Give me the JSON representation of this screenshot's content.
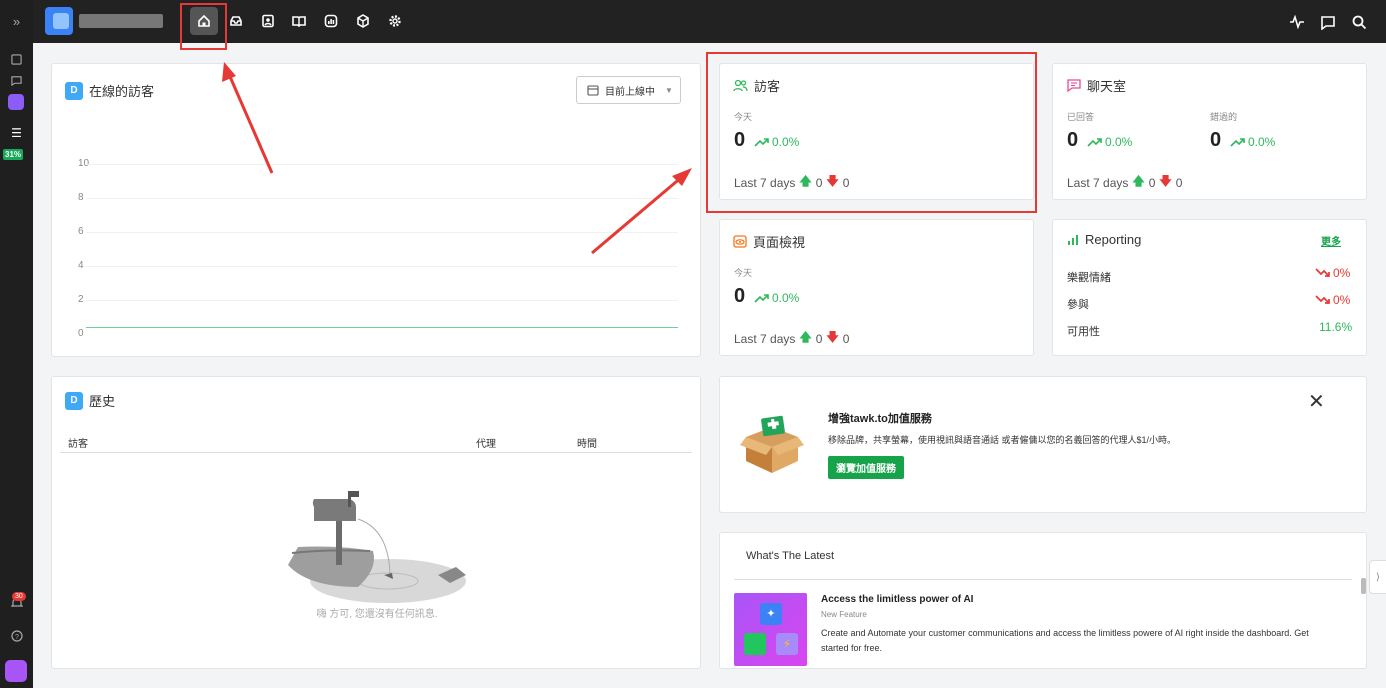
{
  "rail": {
    "progress_badge": "31%",
    "notification_count": "30"
  },
  "nav": {
    "icons": [
      "home-icon",
      "inbox-icon",
      "contacts-icon",
      "knowledge-base-icon",
      "reporting-icon",
      "addons-icon",
      "settings-icon"
    ],
    "right_icons": [
      "activity-icon",
      "chat-icon",
      "search-icon"
    ]
  },
  "online_visitors": {
    "badge": "D",
    "title": "在線的訪客",
    "dropdown": "目前上線中",
    "chart_data": {
      "type": "line",
      "yticks": [
        "10",
        "8",
        "6",
        "4",
        "2",
        "0"
      ],
      "ylim": [
        0,
        10
      ],
      "series": [
        {
          "values": [
            0,
            0
          ]
        }
      ],
      "line_color": "#6fcf97"
    }
  },
  "visitors": {
    "title": "訪客",
    "today_label": "今天",
    "value": "0",
    "trend": "0.0%",
    "last7_label": "Last 7 days",
    "up": "0",
    "down": "0"
  },
  "chat": {
    "title": "聊天室",
    "answered_label": "已回答",
    "answered_value": "0",
    "answered_trend": "0.0%",
    "missed_label": "錯過的",
    "missed_value": "0",
    "missed_trend": "0.0%",
    "last7_label": "Last 7 days",
    "up": "0",
    "down": "0"
  },
  "pageviews": {
    "title": "頁面檢視",
    "today_label": "今天",
    "value": "0",
    "trend": "0.0%",
    "last7_label": "Last 7 days",
    "up": "0",
    "down": "0"
  },
  "reporting": {
    "title": "Reporting",
    "more": "更多",
    "rows": [
      {
        "label": "樂觀情緒",
        "value": "0%"
      },
      {
        "label": "參與",
        "value": "0%"
      },
      {
        "label": "可用性",
        "value": "11.6%"
      }
    ]
  },
  "history": {
    "badge": "D",
    "title": "歷史",
    "columns": [
      "訪客",
      "代理",
      "時間"
    ],
    "empty_message": "嗨 方可, 您還沒有任何訊息."
  },
  "promo": {
    "title": "增強tawk.to加值服務",
    "description": "移除品牌，共享螢幕，使用視訊與語音通話 或者僱傭以您的名義回答的代理人$1/小時。",
    "button": "瀏覽加值服務"
  },
  "latest": {
    "title": "What's The Latest",
    "item_title": "Access the limitless power of AI",
    "item_tag": "New Feature",
    "item_desc": "Create and Automate your customer communications and access the limitless powere of AI right inside the dashboard. Get started for free."
  }
}
